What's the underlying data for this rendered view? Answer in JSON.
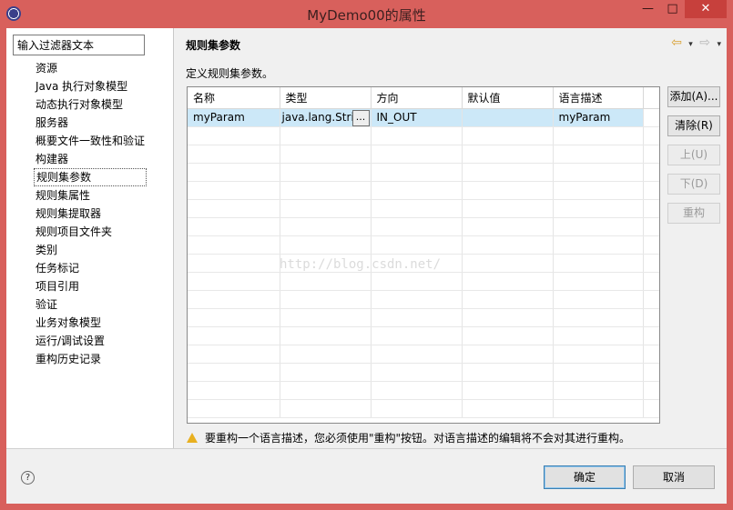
{
  "window": {
    "title": "MyDemo00的属性",
    "min_glyph": "—",
    "max_glyph": "□",
    "close_glyph": "✕"
  },
  "sidebar": {
    "filter_placeholder": "输入过滤器文本",
    "items": [
      {
        "label": "资源"
      },
      {
        "label": "Java 执行对象模型"
      },
      {
        "label": "动态执行对象模型"
      },
      {
        "label": "服务器"
      },
      {
        "label": "概要文件一致性和验证"
      },
      {
        "label": "构建器"
      },
      {
        "label": "规则集参数",
        "selected": true
      },
      {
        "label": "规则集属性"
      },
      {
        "label": "规则集提取器"
      },
      {
        "label": "规则项目文件夹"
      },
      {
        "label": "类别"
      },
      {
        "label": "任务标记"
      },
      {
        "label": "项目引用"
      },
      {
        "label": "验证"
      },
      {
        "label": "业务对象模型"
      },
      {
        "label": "运行/调试设置"
      },
      {
        "label": "重构历史记录"
      }
    ]
  },
  "page": {
    "title": "规则集参数",
    "description": "定义规则集参数。",
    "nav": {
      "back_icon": "back-arrow-icon",
      "forward_icon": "forward-arrow-icon",
      "back": "⇦",
      "forward": "⇨",
      "dropdown": "▾"
    }
  },
  "table": {
    "columns": [
      "名称",
      "类型",
      "方向",
      "默认值",
      "语言描述"
    ],
    "rows": [
      {
        "name": "myParam",
        "type": "java.lang.Strir",
        "direction": "IN_OUT",
        "default": "",
        "verbalization": "myParam"
      }
    ],
    "ellipsis": "..."
  },
  "buttons": {
    "add": "添加(A)...",
    "remove": "清除(R)",
    "up": "上(U)",
    "down": "下(D)",
    "refactor": "重构"
  },
  "warning": {
    "text": "要重构一个语言描述，您必须使用\"重构\"按钮。对语言描述的编辑将不会对其进行重构。"
  },
  "footer": {
    "help": "?",
    "ok": "确定",
    "cancel": "取消"
  },
  "watermark": "http://blog.csdn.net/",
  "colors": {
    "titlebar": "#d8605c",
    "selected_row": "#cce8f8",
    "warning": "#e8b020"
  }
}
